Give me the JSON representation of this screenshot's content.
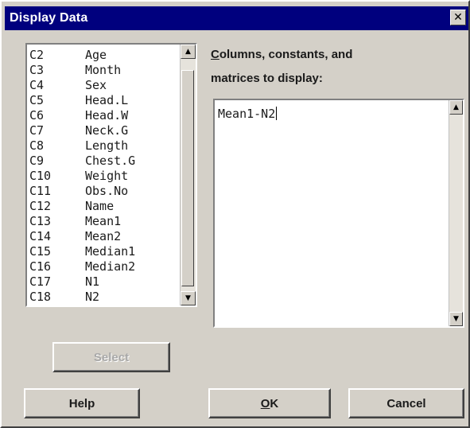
{
  "window": {
    "title": "Display Data",
    "close_glyph": "✕"
  },
  "columns_list": {
    "items": [
      {
        "id": "C2",
        "name": "Age"
      },
      {
        "id": "C3",
        "name": "Month"
      },
      {
        "id": "C4",
        "name": "Sex"
      },
      {
        "id": "C5",
        "name": "Head.L"
      },
      {
        "id": "C6",
        "name": "Head.W"
      },
      {
        "id": "C7",
        "name": "Neck.G"
      },
      {
        "id": "C8",
        "name": "Length"
      },
      {
        "id": "C9",
        "name": "Chest.G"
      },
      {
        "id": "C10",
        "name": "Weight"
      },
      {
        "id": "C11",
        "name": "Obs.No"
      },
      {
        "id": "C12",
        "name": "Name"
      },
      {
        "id": "C13",
        "name": "Mean1"
      },
      {
        "id": "C14",
        "name": "Mean2"
      },
      {
        "id": "C15",
        "name": "Median1"
      },
      {
        "id": "C16",
        "name": "Median2"
      },
      {
        "id": "C17",
        "name": "N1"
      },
      {
        "id": "C18",
        "name": "N2"
      }
    ],
    "scroll_up_glyph": "▲",
    "scroll_down_glyph": "▼"
  },
  "display_field": {
    "label_mnemonic": "C",
    "label_rest": "olumns, constants, and\nmatrices to display:",
    "value": "Mean1-N2",
    "scroll_up_glyph": "▲",
    "scroll_down_glyph": "▼"
  },
  "buttons": {
    "select": "Select",
    "help": "Help",
    "ok_mnemonic": "O",
    "ok_rest": "K",
    "cancel": "Cancel"
  },
  "icons": {
    "close": "close-icon",
    "scroll_up": "arrow-up-icon",
    "scroll_down": "arrow-down-icon"
  },
  "colors": {
    "titlebar": "#00007e",
    "dialog_bg": "#d4d0c8",
    "field_bg": "#ffffff"
  }
}
